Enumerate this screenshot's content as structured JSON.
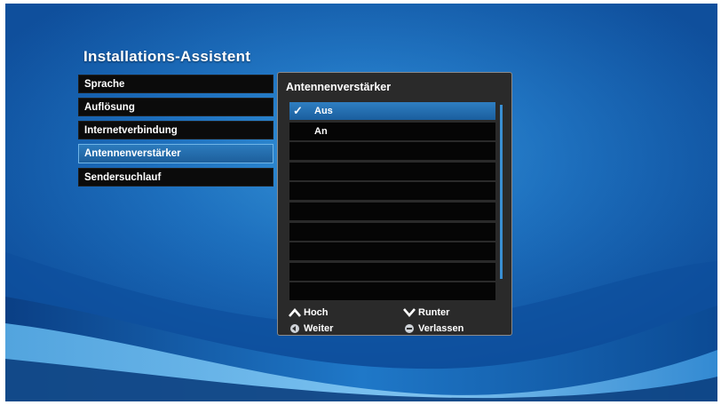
{
  "wizard": {
    "title": "Installations-Assistent",
    "menu": [
      {
        "label": "Sprache"
      },
      {
        "label": "Auflösung"
      },
      {
        "label": "Internetverbindung"
      },
      {
        "label": "Antennenverstärker"
      },
      {
        "label": "Sendersuchlauf"
      }
    ]
  },
  "panel": {
    "title": "Antennenverstärker",
    "options": [
      {
        "label": "Aus",
        "checkmark": "✓"
      },
      {
        "label": "An"
      }
    ]
  },
  "hints": {
    "up": "Hoch",
    "down": "Runter",
    "next": "Weiter",
    "exit": "Verlassen"
  },
  "icons": {
    "up": "chevron-up-icon",
    "down": "chevron-down-icon",
    "next": "back-button-icon",
    "exit": "exit-button-icon"
  },
  "colors": {
    "accent": "#2a7cc0",
    "background": "#1b6fc0",
    "item_bg": "#0b0b0b"
  }
}
